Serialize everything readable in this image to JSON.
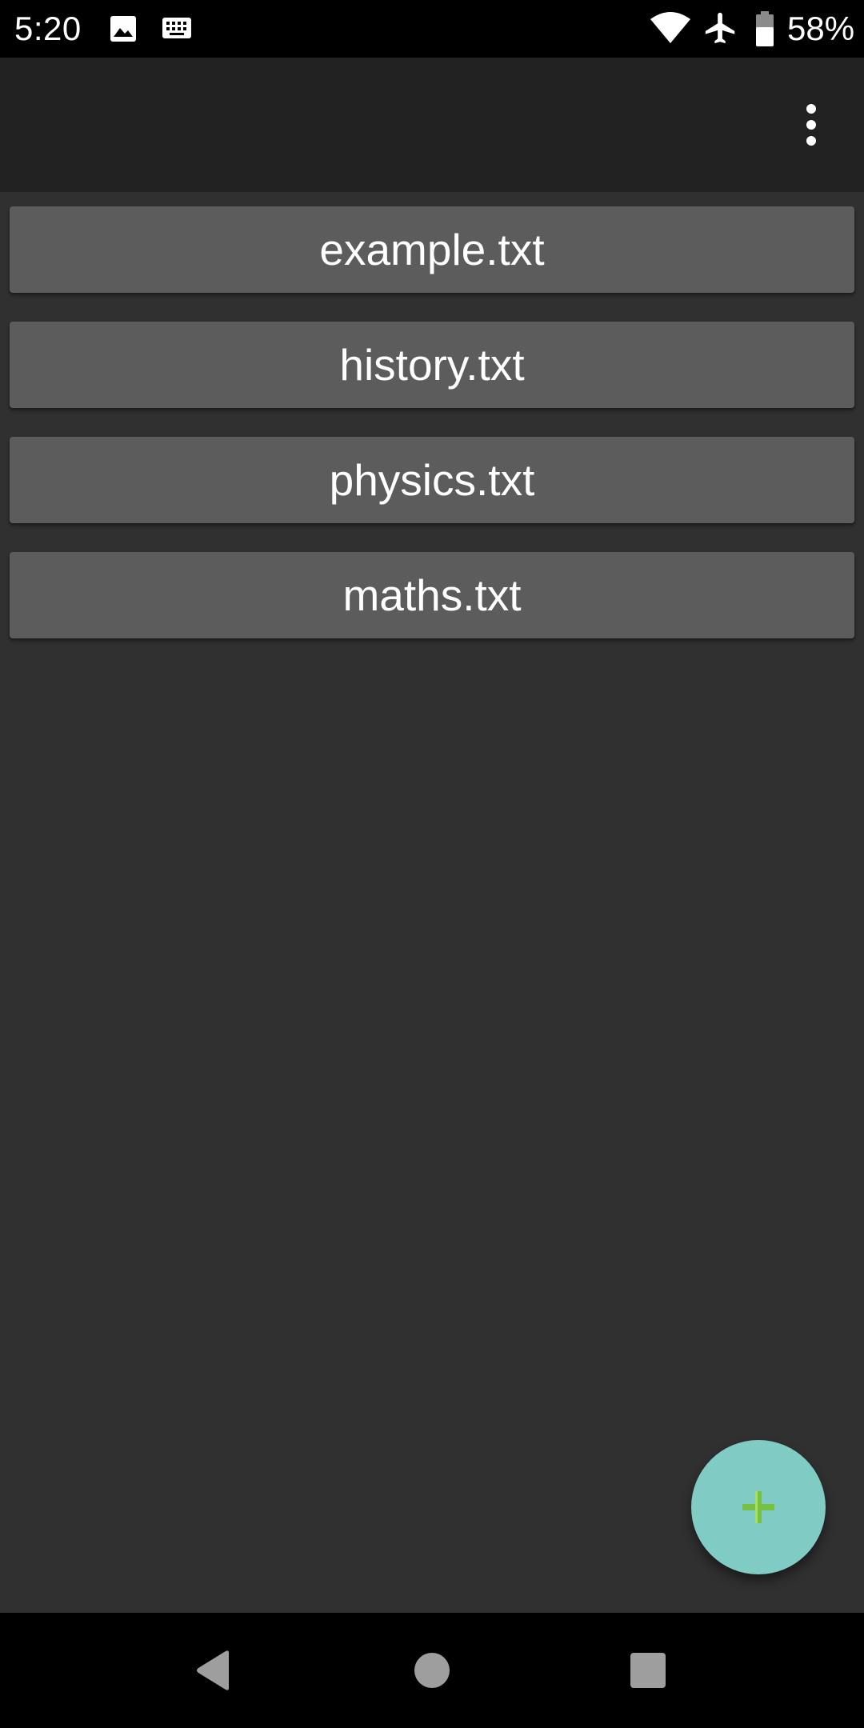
{
  "status_bar": {
    "time": "5:20",
    "battery_percent": "58%",
    "icons": [
      "image-icon",
      "keyboard-icon",
      "wifi-icon",
      "airplane-icon",
      "battery-icon"
    ]
  },
  "app_bar": {
    "overflow_icon": "more-vert-icon"
  },
  "files": [
    {
      "name": "example.txt"
    },
    {
      "name": "history.txt"
    },
    {
      "name": "physics.txt"
    },
    {
      "name": "maths.txt"
    }
  ],
  "fab": {
    "icon": "plus-icon",
    "background_color": "#80cbc4",
    "icon_color": "#76c043"
  },
  "nav_bar": {
    "icons": [
      "back-icon",
      "home-icon",
      "recents-icon"
    ]
  },
  "colors": {
    "background": "#303030",
    "app_bar": "#212121",
    "list_item": "#5c5c5d",
    "text": "#ffffff"
  }
}
